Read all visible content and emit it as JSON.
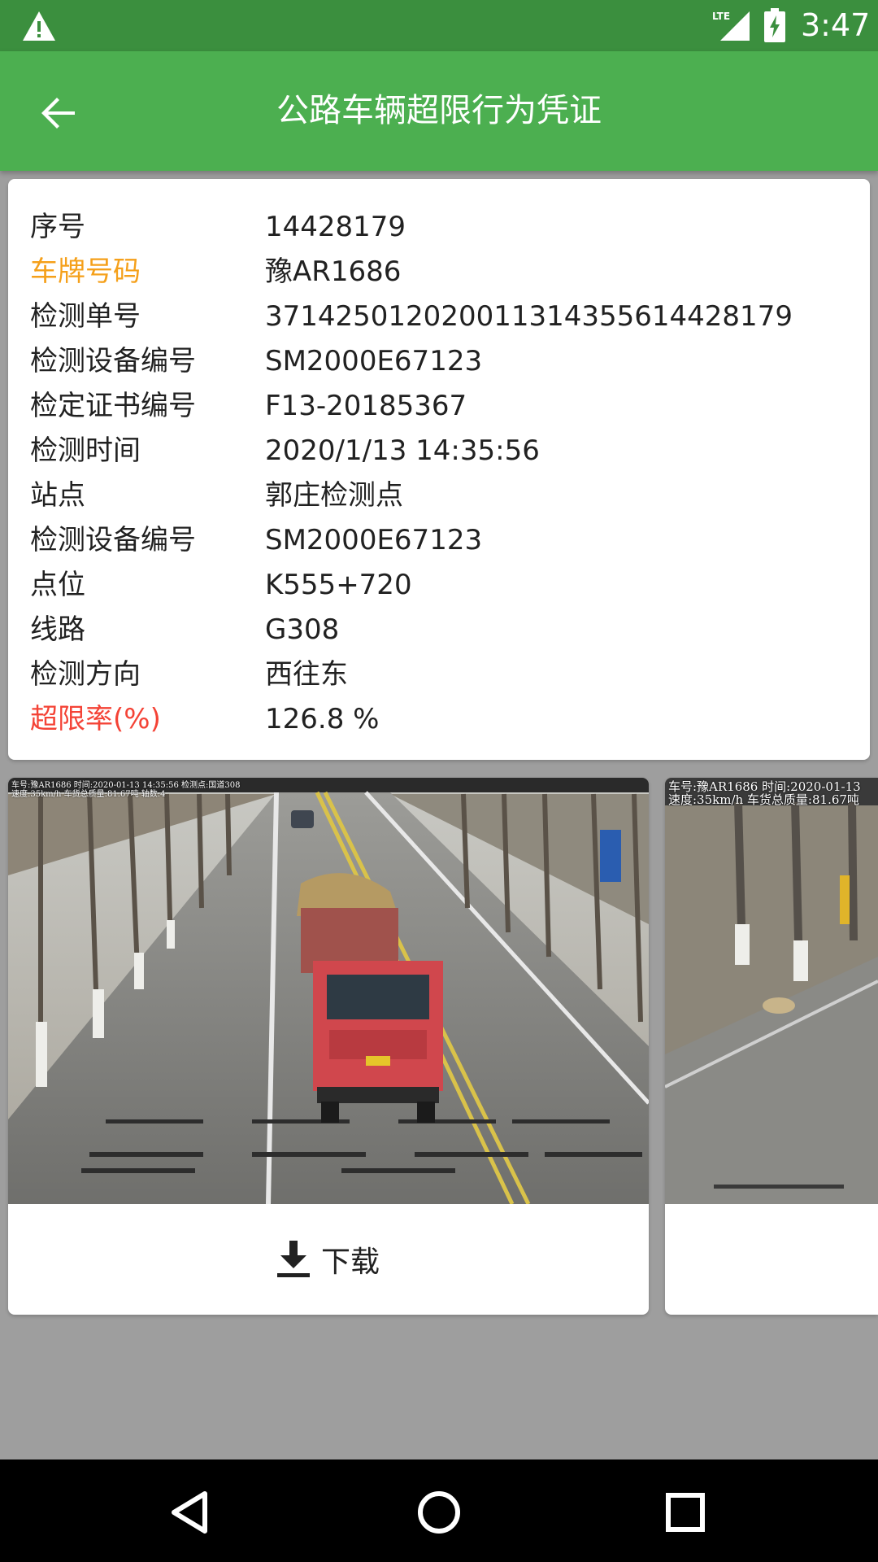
{
  "status_bar": {
    "time": "3:47",
    "network": "LTE",
    "icons": [
      "warning-icon",
      "signal-icon",
      "battery-charging-icon"
    ]
  },
  "app_bar": {
    "title": "公路车辆超限行为凭证",
    "back_icon": "arrow-back-icon"
  },
  "info": {
    "rows": [
      {
        "label": "序号",
        "value": "14428179",
        "label_color": "#212121"
      },
      {
        "label": "车牌号码",
        "value": "豫AR1686",
        "label_color": "#f5a01a"
      },
      {
        "label": "检测单号",
        "value": "371425012020011314355614428179",
        "label_color": "#212121"
      },
      {
        "label": "检测设备编号",
        "value": "SM2000E67123",
        "label_color": "#212121"
      },
      {
        "label": "检定证书编号",
        "value": "F13-20185367",
        "label_color": "#212121"
      },
      {
        "label": "检测时间",
        "value": "2020/1/13 14:35:56",
        "label_color": "#212121"
      },
      {
        "label": "站点",
        "value": "郭庄检测点",
        "label_color": "#212121"
      },
      {
        "label": "检测设备编号",
        "value": "SM2000E67123",
        "label_color": "#212121"
      },
      {
        "label": "点位",
        "value": "K555+720",
        "label_color": "#212121"
      },
      {
        "label": "线路",
        "value": "G308",
        "label_color": "#212121"
      },
      {
        "label": "检测方向",
        "value": "西往东",
        "label_color": "#212121"
      },
      {
        "label": "超限率(%)",
        "value": "126.8 %",
        "label_color": "#f44336"
      }
    ]
  },
  "photos": [
    {
      "overlay_line1": "车号:豫AR1686  时间:2020-01-13 14:35:56  检测点:国道308",
      "overlay_line2": "速度:35km/h  车货总质量:81.67吨  轴数:4",
      "download_label": "下载",
      "download_icon": "download-icon"
    },
    {
      "overlay_line1": "车号:豫AR1686  时间:2020-01-13",
      "overlay_line2": "速度:35km/h  车货总质量:81.67吨"
    }
  ],
  "nav_bar": {
    "icons": [
      "back-triangle-icon",
      "home-circle-icon",
      "recents-square-icon"
    ]
  }
}
